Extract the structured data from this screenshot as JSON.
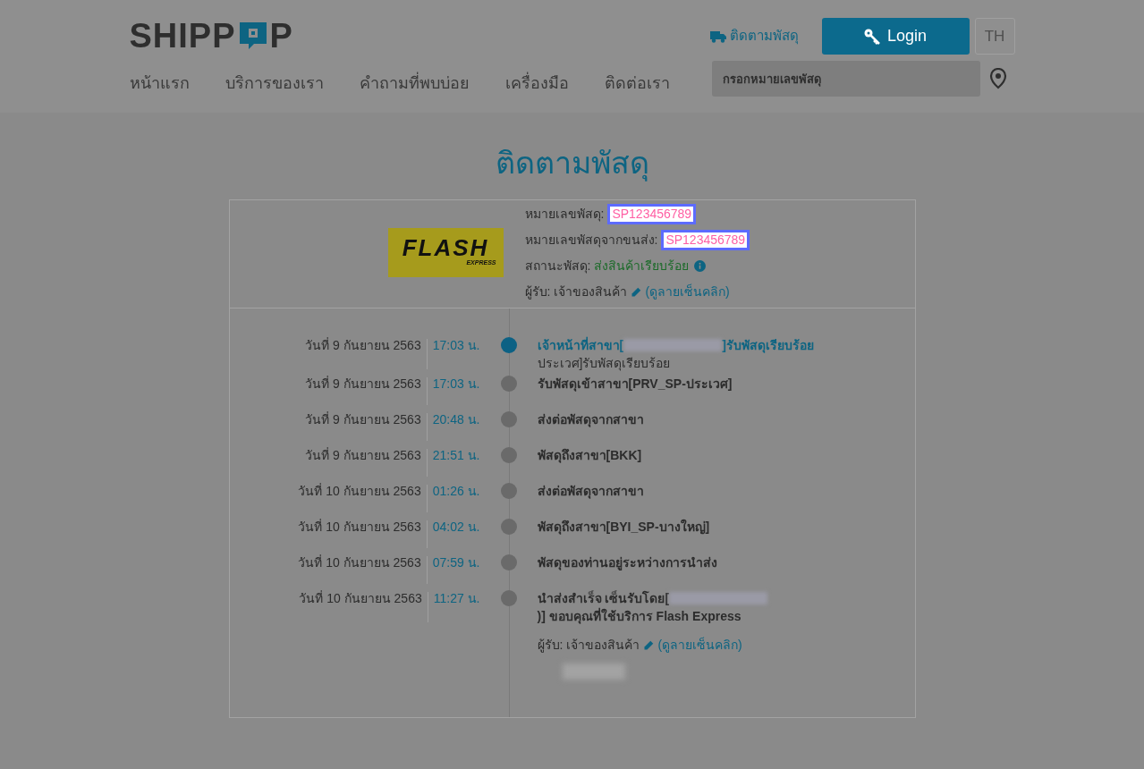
{
  "header": {
    "logo": {
      "text_before": "SHIPP",
      "text_after": "P"
    },
    "track_link": "ติดตามพัสดุ",
    "login_button": "Login",
    "language": "TH",
    "nav": [
      "หน้าแรก",
      "บริการของเรา",
      "คำถามที่พบบ่อย",
      "เครื่องมือ",
      "ติดต่อเรา"
    ],
    "search": {
      "placeholder": "กรอกหมายเลขพัสดุ"
    }
  },
  "page_title": "ติดตามพัสดุ",
  "summary": {
    "carrier_logo": {
      "name": "FLASH",
      "sub": "EXPRESS"
    },
    "fields": [
      {
        "kind": "highlight",
        "label": "หมายเลขพัสดุ:",
        "value": "SP123456789"
      },
      {
        "kind": "highlight",
        "label": "หมายเลขพัสดุจากขนส่ง:",
        "value": "SP123456789"
      },
      {
        "kind": "status",
        "label": "สถานะพัสดุ:",
        "value": "ส่งสินค้าเรียบร้อย"
      },
      {
        "kind": "receiver",
        "label": "ผู้รับ:",
        "value": "เจ้าของสินค้า",
        "link": "(ดูลายเซ็นคลิก)"
      }
    ]
  },
  "timeline": [
    {
      "date": "วันที่ 9 กันยายน 2563",
      "time": "17:03 น.",
      "active": true,
      "text": [
        {
          "kind": "text",
          "text": "เจ้าหน้าที่สาขา["
        },
        {
          "kind": "redacted"
        },
        {
          "kind": "text",
          "text": "]รับพัสดุเรียบร้อย"
        }
      ],
      "detail": "ประเวศ]รับพัสดุเรียบร้อย"
    },
    {
      "date": "วันที่ 9 กันยายน 2563",
      "time": "17:03 น.",
      "active": false,
      "text": [
        {
          "kind": "text",
          "text": "รับพัสดุเข้าสาขา[PRV_SP-ประเวศ]"
        }
      ]
    },
    {
      "date": "วันที่ 9 กันยายน 2563",
      "time": "20:48 น.",
      "active": false,
      "text": [
        {
          "kind": "text",
          "text": "ส่งต่อพัสดุจากสาขา"
        }
      ]
    },
    {
      "date": "วันที่ 9 กันยายน 2563",
      "time": "21:51 น.",
      "active": false,
      "text": [
        {
          "kind": "text",
          "text": "พัสดุถึงสาขา[BKK]"
        }
      ]
    },
    {
      "date": "วันที่ 10 กันยายน 2563",
      "time": "01:26 น.",
      "active": false,
      "text": [
        {
          "kind": "text",
          "text": "ส่งต่อพัสดุจากสาขา"
        }
      ]
    },
    {
      "date": "วันที่ 10 กันยายน 2563",
      "time": "04:02 น.",
      "active": false,
      "text": [
        {
          "kind": "text",
          "text": "พัสดุถึงสาขา[BYI_SP-บางใหญ่]"
        }
      ]
    },
    {
      "date": "วันที่ 10 กันยายน 2563",
      "time": "07:59 น.",
      "active": false,
      "text": [
        {
          "kind": "text",
          "text": "พัสดุของท่านอยู่ระหว่างการนำส่ง"
        }
      ]
    },
    {
      "date": "วันที่ 10 กันยายน 2563",
      "time": "11:27 น.",
      "active": false,
      "text": [
        {
          "kind": "text",
          "text": "นำส่งสำเร็จ เซ็นรับโดย["
        },
        {
          "kind": "redacted"
        },
        {
          "kind": "text",
          "text": ")] ขอบคุณที่ใช้บริการ Flash Express"
        }
      ]
    }
  ],
  "receiver": {
    "label": "ผู้รับ:",
    "value": "เจ้าของสินค้า",
    "link": "(ดูลายเซ็นคลิก)"
  }
}
